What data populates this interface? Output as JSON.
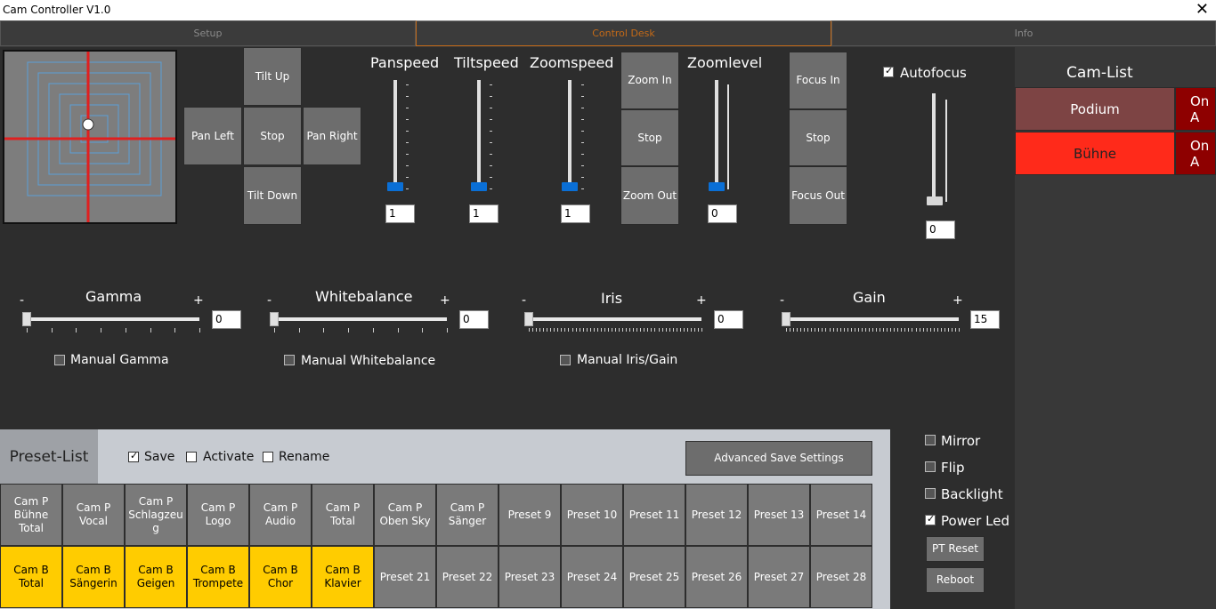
{
  "window": {
    "title": "Cam Controller V1.0",
    "close": "✕"
  },
  "tabs": [
    "Setup",
    "Control Desk",
    "Info"
  ],
  "ptz": {
    "tilt_up": "Tilt Up",
    "pan_left": "Pan Left",
    "stop": "Stop",
    "pan_right": "Pan Right",
    "tilt_down": "Tilt Down"
  },
  "speeds": {
    "panspeed": {
      "label": "Panspeed",
      "value": "1"
    },
    "tiltspeed": {
      "label": "Tiltspeed",
      "value": "1"
    },
    "zoomspeed": {
      "label": "Zoomspeed",
      "value": "1"
    }
  },
  "zoom": {
    "in": "Zoom In",
    "stop": "Stop",
    "out": "Zoom Out",
    "level_label": "Zoomlevel",
    "level_value": "0"
  },
  "focus": {
    "in": "Focus In",
    "stop": "Stop",
    "out": "Focus Out",
    "autofocus": "Autofocus",
    "value": "0"
  },
  "image": {
    "minus": "-",
    "plus": "+",
    "gamma": {
      "label": "Gamma",
      "value": "0",
      "manual": "Manual Gamma"
    },
    "whitebalance": {
      "label": "Whitebalance",
      "value": "0",
      "manual": "Manual Whitebalance"
    },
    "iris": {
      "label": "Iris",
      "value": "0",
      "manual": "Manual Iris/Gain"
    },
    "gain": {
      "label": "Gain",
      "value": "15"
    }
  },
  "presets": {
    "title": "Preset-List",
    "save": "Save",
    "activate": "Activate",
    "rename": "Rename",
    "advanced": "Advanced Save Settings",
    "row1": [
      "Cam P Bühne Total",
      "Cam P Vocal",
      "Cam P Schlagzeu g",
      "Cam P Logo",
      "Cam P Audio",
      "Cam P Total",
      "Cam P Oben Sky",
      "Cam P Sänger",
      "Preset 9",
      "Preset 10",
      "Preset 11",
      "Preset 12",
      "Preset 13",
      "Preset 14"
    ],
    "row2": [
      "Cam B Total",
      "Cam B Sängerin",
      "Cam B Geigen",
      "Cam B Trompete",
      "Cam B Chor",
      "Cam B Klavier",
      "Preset 21",
      "Preset 22",
      "Preset 23",
      "Preset 24",
      "Preset 25",
      "Preset 26",
      "Preset 27",
      "Preset 28"
    ]
  },
  "options": {
    "mirror": "Mirror",
    "flip": "Flip",
    "backlight": "Backlight",
    "power_led": "Power Led",
    "pt_reset": "PT Reset",
    "reboot": "Reboot"
  },
  "camlist": {
    "title": "Cam-List",
    "cams": [
      {
        "name": "Podium",
        "state": "On A"
      },
      {
        "name": "Bühne",
        "state": "On A"
      }
    ]
  },
  "colors": {
    "accent": "#c46a17",
    "slider": "#0a6fd6",
    "preset_yellow": "#ffcc00",
    "cam_active": "#ff2a1a",
    "cam_idle": "#7d4444"
  }
}
